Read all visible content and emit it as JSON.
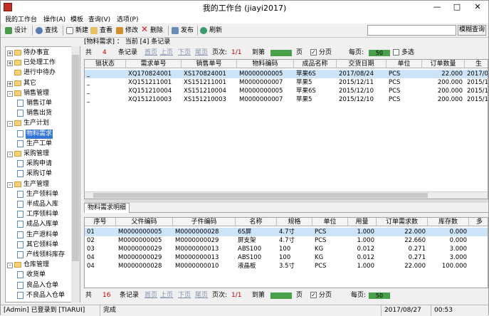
{
  "window": {
    "title": "我的工作台 (jiayi2017)",
    "min": "—",
    "max": "□",
    "close": "✕"
  },
  "menu": [
    "我的工作台",
    "操作(A)",
    "模板",
    "查询(V)",
    "选项(P)"
  ],
  "toolbar": {
    "design": "设计",
    "find": "查找",
    "new": "新建",
    "view": "查看",
    "edit": "修改",
    "delete": "删除",
    "publish": "发布",
    "refresh": "刷新",
    "search_btn": "模糊查询",
    "search_value": ""
  },
  "breadcrumb": "[物料需求] ： 当前 [4] 条记录",
  "tree": [
    {
      "label": "待办事宜",
      "level": 0,
      "pm": "+"
    },
    {
      "label": "已处理工作",
      "level": 0,
      "pm": "+"
    },
    {
      "label": "进行中待办",
      "level": 0,
      "pm": ""
    },
    {
      "label": "其它",
      "level": 0,
      "pm": "+"
    },
    {
      "label": "销售管理",
      "level": 0,
      "pm": "-"
    },
    {
      "label": "销售订单",
      "level": 1,
      "pm": ""
    },
    {
      "label": "销售出货",
      "level": 1,
      "pm": ""
    },
    {
      "label": "生产计划",
      "level": 0,
      "pm": "-"
    },
    {
      "label": "物料需求",
      "level": 1,
      "pm": "",
      "selected": true
    },
    {
      "label": "生产工单",
      "level": 1,
      "pm": ""
    },
    {
      "label": "采购管理",
      "level": 0,
      "pm": "-"
    },
    {
      "label": "采购申请",
      "level": 1,
      "pm": ""
    },
    {
      "label": "采购订单",
      "level": 1,
      "pm": ""
    },
    {
      "label": "生产管理",
      "level": 0,
      "pm": "-"
    },
    {
      "label": "生产领料单",
      "level": 1,
      "pm": ""
    },
    {
      "label": "半成品入库",
      "level": 1,
      "pm": ""
    },
    {
      "label": "工序领料单",
      "level": 1,
      "pm": ""
    },
    {
      "label": "成品入库单",
      "level": 1,
      "pm": ""
    },
    {
      "label": "生产退料单",
      "level": 1,
      "pm": ""
    },
    {
      "label": "其它领料单",
      "level": 1,
      "pm": ""
    },
    {
      "label": "产线领料库存",
      "level": 1,
      "pm": ""
    },
    {
      "label": "仓库管理",
      "level": 0,
      "pm": "-"
    },
    {
      "label": "收货单",
      "level": 1,
      "pm": ""
    },
    {
      "label": "良品入仓单",
      "level": 1,
      "pm": ""
    },
    {
      "label": "不良品入仓单",
      "level": 1,
      "pm": ""
    }
  ],
  "top_nav": {
    "total_label": "共",
    "total": "4",
    "records": "条记录",
    "first": "首页",
    "prev": "上页",
    "next": "下页",
    "last": "尾页",
    "pages_label": "页次:",
    "pages": "1/1",
    "goto": "到第",
    "page_unit": "页",
    "paging": "分页",
    "per_page": "每页:",
    "per_page_val": "50",
    "multi": "多选"
  },
  "master_grid": {
    "headers": [
      "锁状态",
      "需求单号",
      "销售单号",
      "物料编码",
      "成品名称",
      "交货日期",
      "单位",
      "订单数量",
      "生"
    ],
    "rows": [
      [
        "",
        "XQ170824001",
        "XS170824001",
        "M0000000005",
        "苹果6S",
        "2017/08/24",
        "PCS",
        "22.000",
        "2017/0"
      ],
      [
        "",
        "XQ151211001",
        "XS151211001",
        "M0000000007",
        "苹果5",
        "2015/12/11",
        "PCS",
        "200.000",
        "2015/1"
      ],
      [
        "",
        "XQ151210004",
        "XS151210004",
        "M0000000005",
        "苹果6S",
        "2015/12/10",
        "PCS",
        "200.000",
        "2015/1"
      ],
      [
        "",
        "XQ151210003",
        "XS151210003",
        "M0000000007",
        "苹果5",
        "2015/12/10",
        "PCS",
        "200.000",
        "2015/1"
      ]
    ]
  },
  "detail_tab": "物料需求明细",
  "detail_grid": {
    "headers": [
      "序号",
      "父件编码",
      "子件编码",
      "名称",
      "规格",
      "单位",
      "用量",
      "订单需求数",
      "库存数",
      "多"
    ],
    "rows": [
      [
        "01",
        "M0000000005",
        "M0000000028",
        "6S屏",
        "4.7寸",
        "PCS",
        "1.000",
        "22.000",
        "0.000",
        ""
      ],
      [
        "02",
        "M0000000005",
        "M0000000029",
        "屏支架",
        "4.7寸",
        "PCS",
        "1.000",
        "22.660",
        "0.000",
        ""
      ],
      [
        "03",
        "M0000000029",
        "M0000000013",
        "ABS100",
        "100",
        "KG",
        "0.012",
        "0.271",
        "3.000",
        ""
      ],
      [
        "04",
        "M0000000029",
        "M0000000013",
        "ABS100",
        "100",
        "KG",
        "0.012",
        "0.271",
        "3.000",
        ""
      ],
      [
        "04",
        "M0000000028",
        "M0000000010",
        "液晶板",
        "3.5寸",
        "PCS",
        "1.000",
        "22.000",
        "100.000",
        ""
      ]
    ]
  },
  "bottom_nav": {
    "total_label": "共",
    "total": "16",
    "records": "条记录",
    "first": "首页",
    "prev": "上页",
    "next": "下页",
    "last": "尾页",
    "pages_label": "页次:",
    "pages": "1/1",
    "goto": "到第",
    "page_unit": "页",
    "paging": "分页",
    "per_page": "每页:",
    "per_page_val": "50"
  },
  "status": {
    "user": "[Admin] 已登录到 [TIARUI]",
    "state": "完成",
    "date": "2017/08/27",
    "time": "00:53"
  }
}
